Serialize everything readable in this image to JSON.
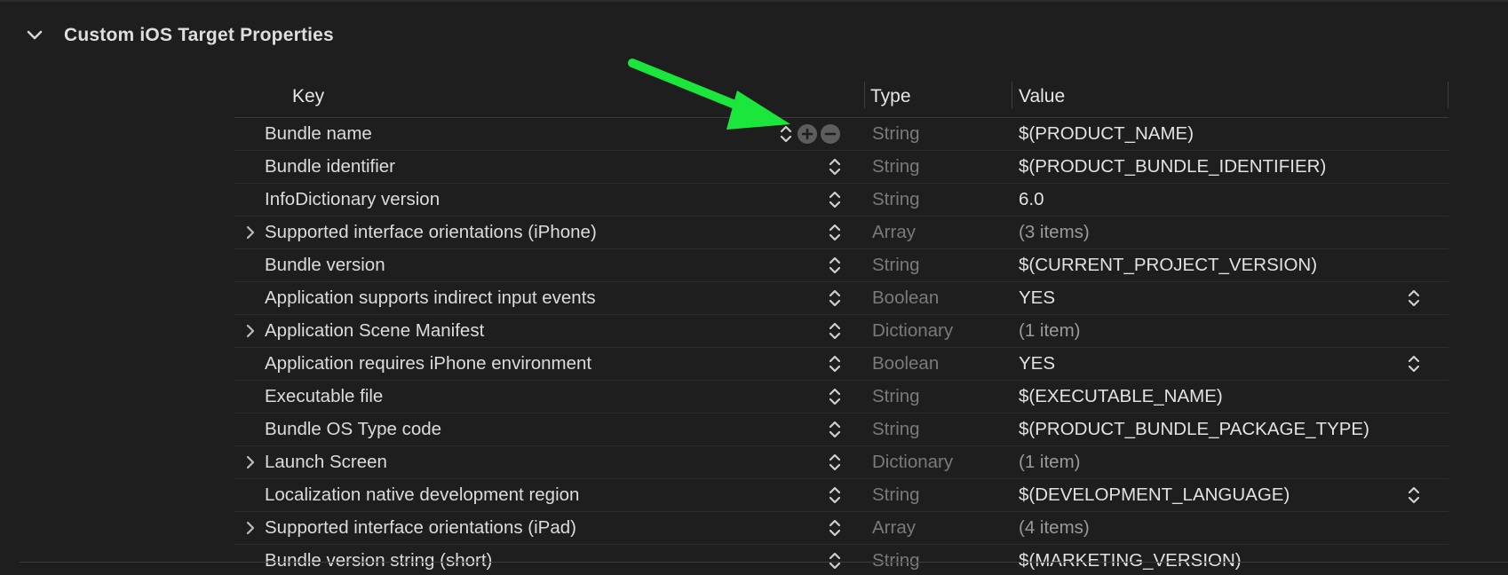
{
  "section": {
    "title": "Custom iOS Target Properties"
  },
  "table": {
    "headers": {
      "key": "Key",
      "type": "Type",
      "value": "Value"
    },
    "rows": [
      {
        "key": "Bundle name",
        "type": "String",
        "value": "$(PRODUCT_NAME)",
        "expandable": false,
        "value_dim": false,
        "value_stepper": false,
        "selected_controls": true
      },
      {
        "key": "Bundle identifier",
        "type": "String",
        "value": "$(PRODUCT_BUNDLE_IDENTIFIER)",
        "expandable": false,
        "value_dim": false,
        "value_stepper": false
      },
      {
        "key": "InfoDictionary version",
        "type": "String",
        "value": "6.0",
        "expandable": false,
        "value_dim": false,
        "value_stepper": false
      },
      {
        "key": "Supported interface orientations (iPhone)",
        "type": "Array",
        "value": "(3 items)",
        "expandable": true,
        "value_dim": true,
        "value_stepper": false
      },
      {
        "key": "Bundle version",
        "type": "String",
        "value": "$(CURRENT_PROJECT_VERSION)",
        "expandable": false,
        "value_dim": false,
        "value_stepper": false
      },
      {
        "key": "Application supports indirect input events",
        "type": "Boolean",
        "value": "YES",
        "expandable": false,
        "value_dim": false,
        "value_stepper": true
      },
      {
        "key": "Application Scene Manifest",
        "type": "Dictionary",
        "value": "(1 item)",
        "expandable": true,
        "value_dim": true,
        "value_stepper": false
      },
      {
        "key": "Application requires iPhone environment",
        "type": "Boolean",
        "value": "YES",
        "expandable": false,
        "value_dim": false,
        "value_stepper": true
      },
      {
        "key": "Executable file",
        "type": "String",
        "value": "$(EXECUTABLE_NAME)",
        "expandable": false,
        "value_dim": false,
        "value_stepper": false
      },
      {
        "key": "Bundle OS Type code",
        "type": "String",
        "value": "$(PRODUCT_BUNDLE_PACKAGE_TYPE)",
        "expandable": false,
        "value_dim": false,
        "value_stepper": false
      },
      {
        "key": "Launch Screen",
        "type": "Dictionary",
        "value": "(1 item)",
        "expandable": true,
        "value_dim": true,
        "value_stepper": false
      },
      {
        "key": "Localization native development region",
        "type": "String",
        "value": "$(DEVELOPMENT_LANGUAGE)",
        "expandable": false,
        "value_dim": false,
        "value_stepper": true
      },
      {
        "key": "Supported interface orientations (iPad)",
        "type": "Array",
        "value": "(4 items)",
        "expandable": true,
        "value_dim": true,
        "value_stepper": false
      },
      {
        "key": "Bundle version string (short)",
        "type": "String",
        "value": "$(MARKETING_VERSION)",
        "expandable": false,
        "value_dim": false,
        "value_stepper": false
      }
    ]
  },
  "icons": {
    "section_disclosure": "chevron-down-icon",
    "row_disclosure": "chevron-right-icon",
    "type_stepper": "up-down-chevron-icon",
    "add": "plus-circle-icon",
    "remove": "minus-circle-icon",
    "annotation": "green-arrow-icon"
  },
  "colors": {
    "background": "#1e1e1e",
    "annotation_arrow": "#1be63c",
    "type_text": "#7a7a7a"
  }
}
